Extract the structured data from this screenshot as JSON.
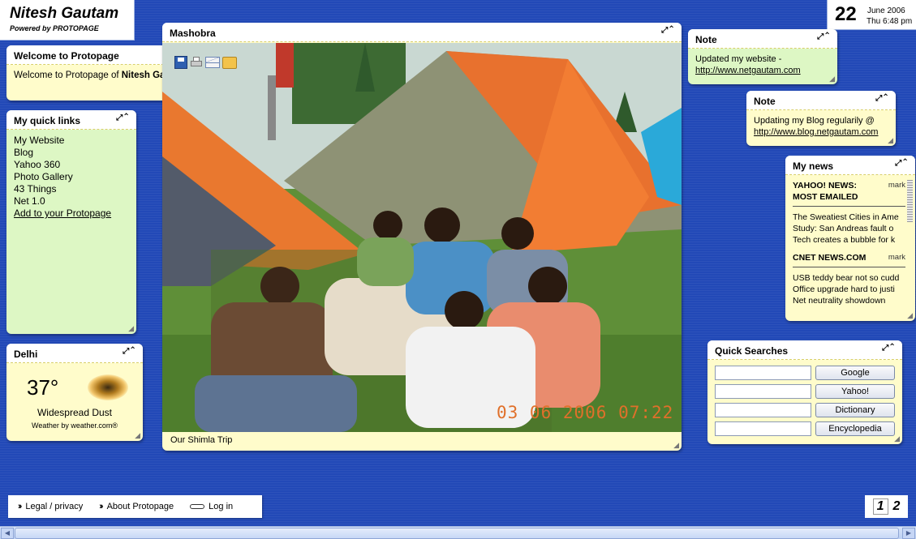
{
  "header": {
    "owner_name": "Nitesh Gautam",
    "powered_by": "Powered by PROTOPAGE"
  },
  "date": {
    "day": "22",
    "month_year": "June 2006",
    "weekday_time": "Thu 6:48 pm"
  },
  "welcome": {
    "title": "Welcome to Protopage",
    "text_prefix": "Welcome to Protopage of ",
    "text_name": "Nitesh Gautam"
  },
  "quick_links": {
    "title": "My quick links",
    "items": [
      "My Website",
      "Blog",
      "Yahoo 360",
      "Photo Gallery",
      "43 Things",
      "Net 1.0"
    ],
    "add_link": "Add to your Protopage"
  },
  "weather": {
    "title": "Delhi",
    "temperature": "37°",
    "condition": "Widespread Dust",
    "credit": "Weather by weather.com®"
  },
  "photo": {
    "title": "Mashobra",
    "caption": "Our Shimla Trip",
    "timestamp": "03 06 2006 07:22"
  },
  "note1": {
    "title": "Note",
    "text": "Updated my website -",
    "link": "http://www.netgautam.com"
  },
  "note2": {
    "title": "Note",
    "text": "Updating my Blog regularily @",
    "link": "http://www.blog.netgautam.com"
  },
  "news": {
    "title": "My news",
    "sources": [
      {
        "name": "YAHOO! NEWS: MOST EMAILED",
        "mark": "mark",
        "items": [
          "The Sweatiest Cities in Ame",
          "Study: San Andreas fault o",
          "Tech creates a bubble for k"
        ]
      },
      {
        "name": "CNET NEWS.COM",
        "mark": "mark",
        "items": [
          "USB teddy bear not so cudd",
          "Office upgrade hard to justi",
          "Net neutrality showdown"
        ]
      }
    ]
  },
  "quick_searches": {
    "title": "Quick Searches",
    "buttons": [
      "Google",
      "Yahoo!",
      "Dictionary",
      "Encyclopedia"
    ]
  },
  "footer": {
    "legal": "Legal / privacy",
    "about": "About Protopage",
    "login": "Log in"
  },
  "pages": [
    "1",
    "2"
  ],
  "colors": {
    "background": "#2249b7",
    "panel_yellow": "#fffccb",
    "panel_green": "#ddf7c4",
    "timestamp_orange": "#e0702a"
  },
  "icons": [
    "save-icon",
    "print-icon",
    "email-icon",
    "folder-icon",
    "maximize-icon",
    "collapse-icon",
    "resize-grip-icon",
    "key-icon",
    "double-chevron-icon"
  ]
}
